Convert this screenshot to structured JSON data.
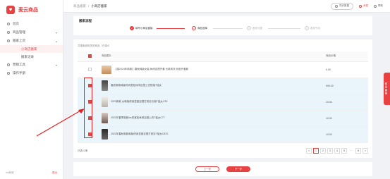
{
  "app": {
    "name": "麦云商品"
  },
  "sidebar": {
    "items": [
      {
        "label": "首页",
        "icon": "home-icon",
        "type": "item"
      },
      {
        "label": "商品管理",
        "icon": "box-icon",
        "type": "item",
        "arrow": "▾"
      },
      {
        "label": "搬家上货",
        "icon": "upload-icon",
        "type": "item",
        "arrow": "▴"
      },
      {
        "label": "小商店搬家",
        "type": "sub",
        "active": true
      },
      {
        "label": "搬家记录",
        "type": "sub"
      },
      {
        "label": "营销工具",
        "icon": "tool-icon",
        "type": "item",
        "arrow": "▾"
      },
      {
        "label": "操作手册",
        "icon": "book-icon",
        "type": "item"
      }
    ],
    "footer_left": "ink商城",
    "footer_right": "退出"
  },
  "topbar": {
    "breadcrumb": [
      "商品搬家",
      "小商店搬家"
    ],
    "sep": "/",
    "btn_label": "同步数据",
    "item1": "消息",
    "item2": "帮助"
  },
  "steps": {
    "title": "搬家流程",
    "items": [
      {
        "num": "✓",
        "label": "填写小商店链接",
        "state": "done"
      },
      {
        "num": "2",
        "label": "商品选择",
        "state": "current"
      },
      {
        "num": "3",
        "label": "搬家设置",
        "state": "todo"
      },
      {
        "num": "4",
        "label": "搬家完成",
        "state": "todo"
      }
    ]
  },
  "table": {
    "info": "共搜索到相关的商品（已选4）",
    "headers": {
      "select": "",
      "product": "商品图片",
      "price": "商品价格"
    },
    "rows": [
      {
        "title": "【感2024年新款】春秋韩版女装 休闲百搭外套 长款风衣 纯色外套款",
        "price": "0.00",
        "checked": false,
        "thumb": "t0"
      },
      {
        "title": "春夏新款韩版时尚宽松休闲百搭上衣短袖T恤女",
        "price": "999.00",
        "checked": true,
        "thumb": "t1"
      },
      {
        "title": "2021新款 女韩版修身显瘦百搭打底衫长袖T恤女C30",
        "price": "10.00",
        "checked": true,
        "thumb": "t2"
      },
      {
        "title": "2021年春季新款ins风宽松休闲百搭上衣T恤女C77",
        "price": "10.00",
        "checked": true,
        "thumb": "t3"
      },
      {
        "title": "2021年春秋新款韩版修身显瘦百搭打底衫T恤女C870",
        "price": "10.00",
        "checked": true,
        "thumb": "t4"
      }
    ],
    "total": "已选 4 条",
    "pages": [
      "<",
      "1",
      "2",
      "3",
      "4",
      "5",
      "…",
      "8",
      ">"
    ]
  },
  "actions": {
    "prev": "上一步",
    "next": "下一步"
  },
  "float_tab": "联系客服"
}
